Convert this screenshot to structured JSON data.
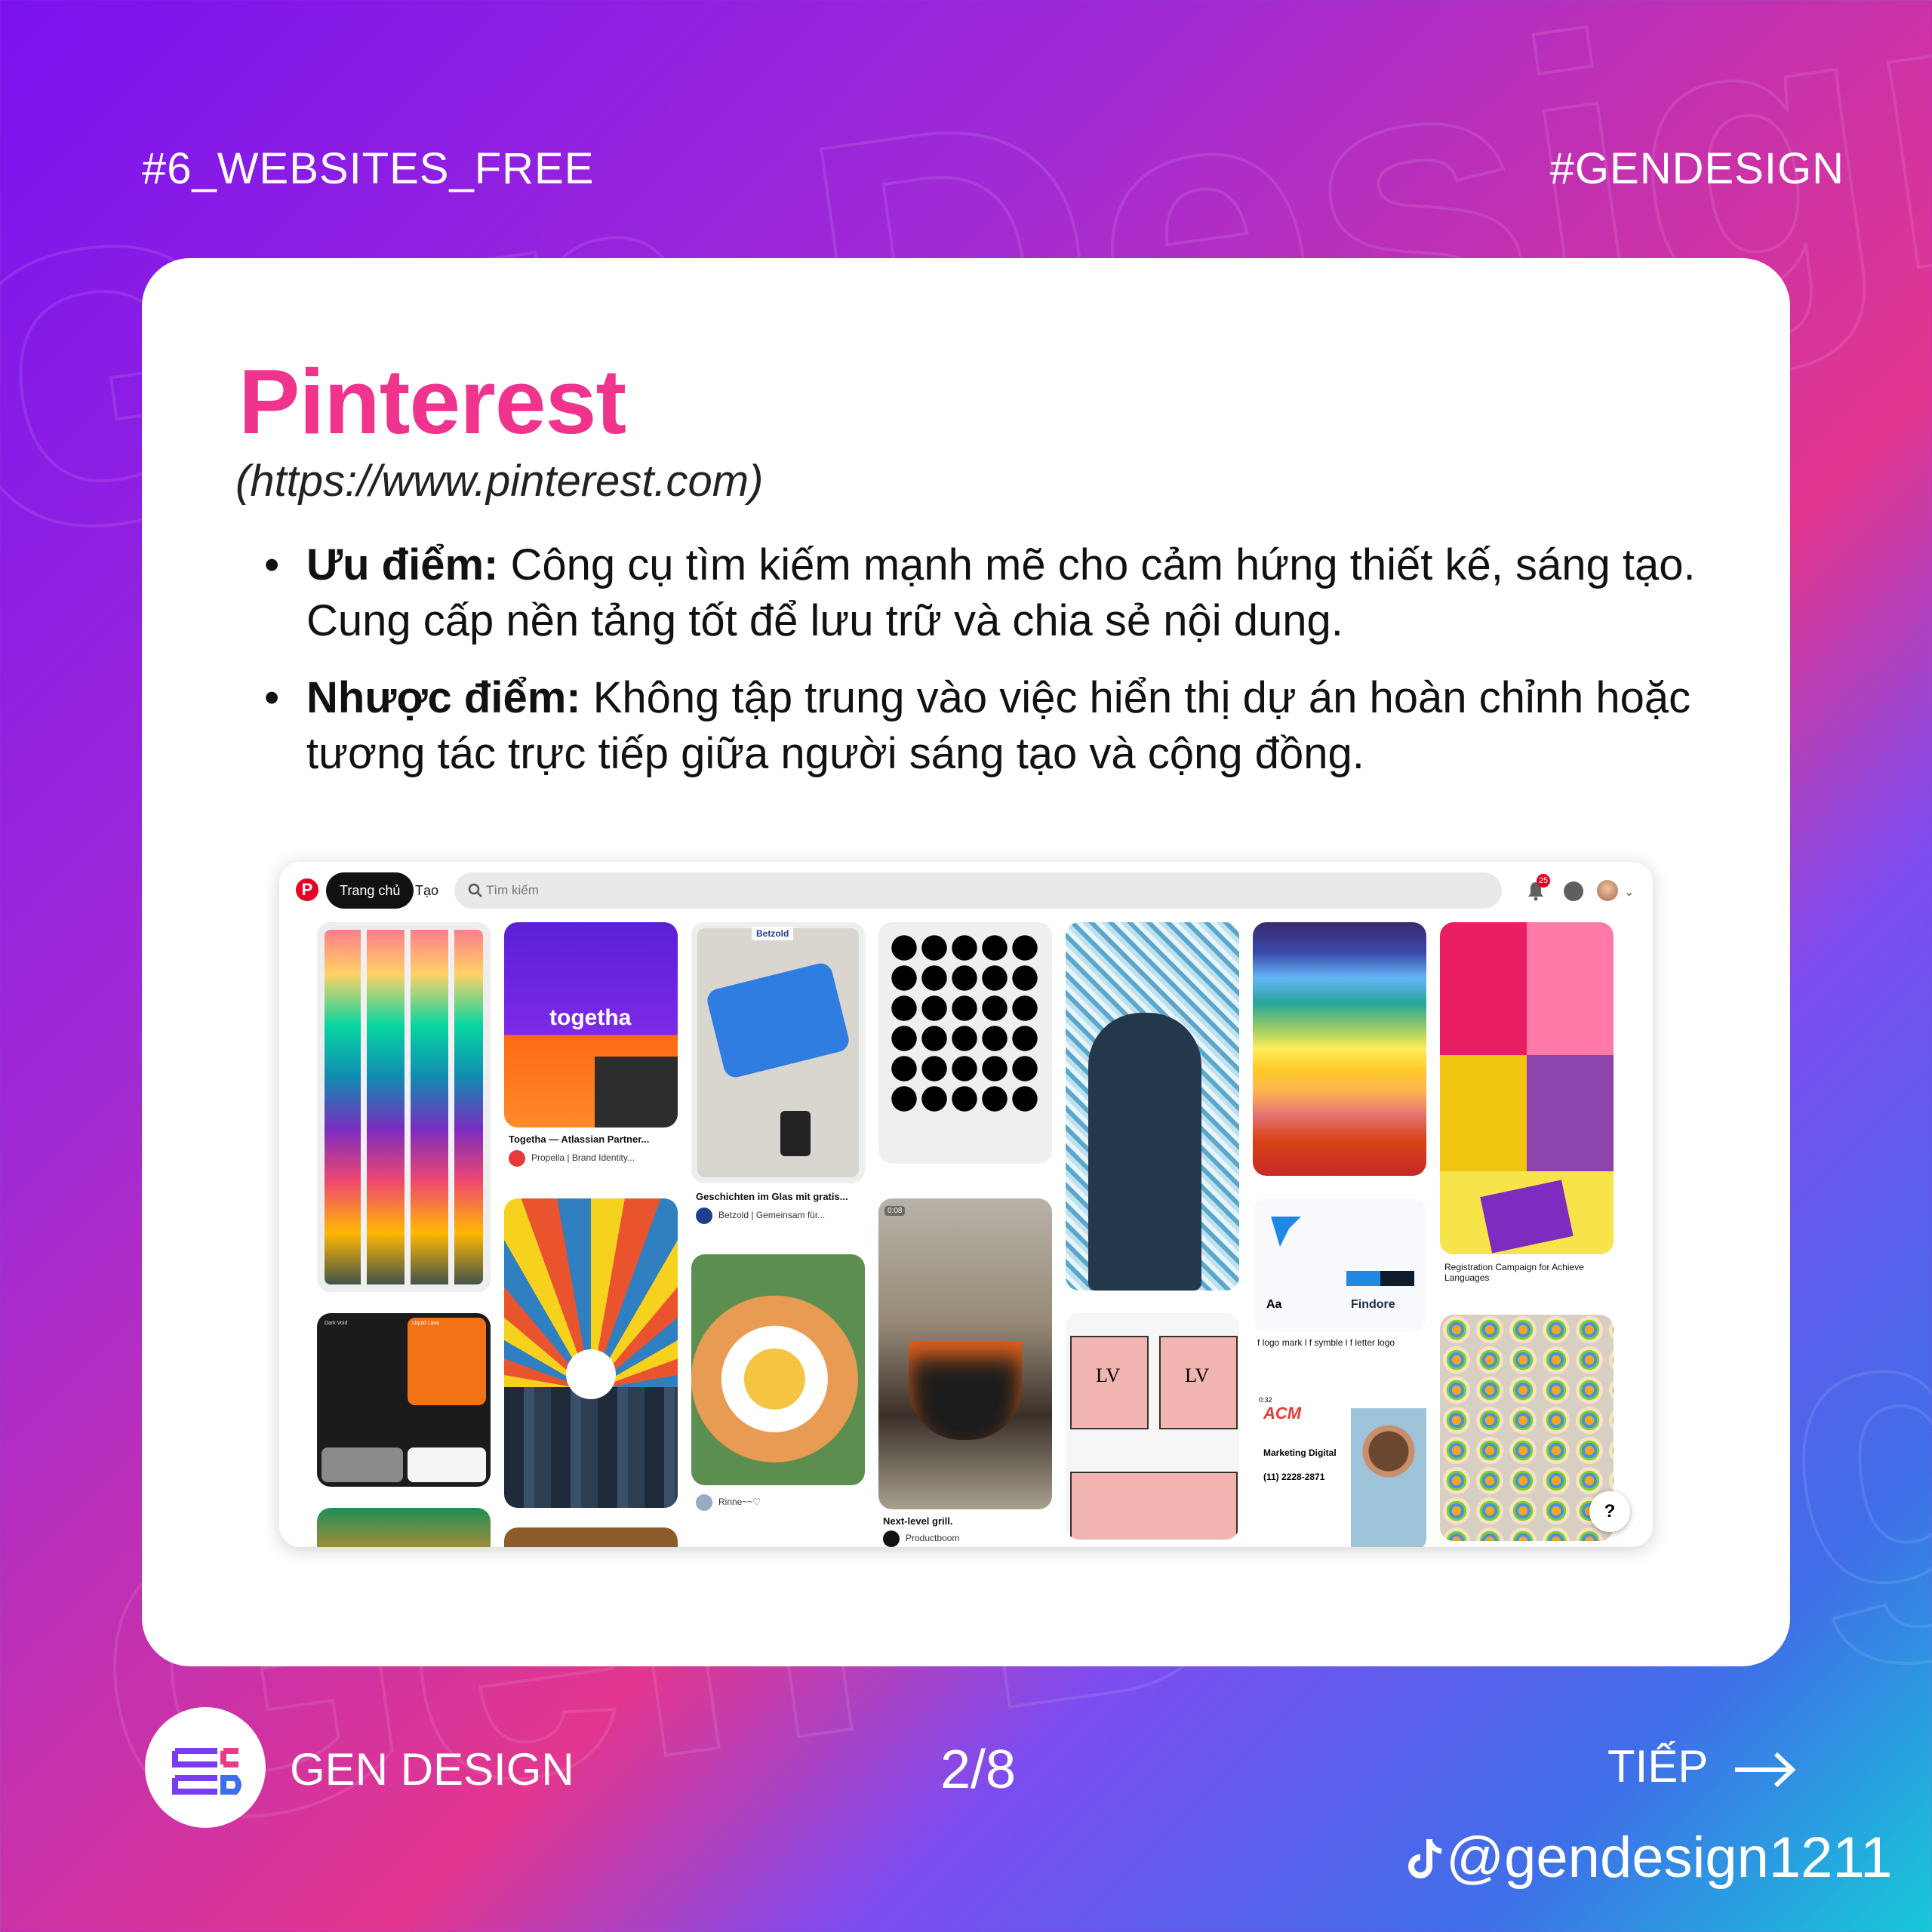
{
  "header": {
    "left_tag": "#6_WEBSITES_FREE",
    "right_tag": "#GENDESIGN"
  },
  "card": {
    "title": "Pinterest",
    "url": "(https://www.pinterest.com)",
    "bullets": [
      {
        "label": "Ưu điểm:",
        "text": " Công cụ tìm kiếm mạnh mẽ cho cảm hứng thiết kế, sáng tạo. Cung cấp nền tảng tốt để lưu trữ và chia sẻ nội dung."
      },
      {
        "label": "Nhược điểm:",
        "text": " Không tập trung vào việc hiển thị dự án hoàn chỉnh hoặc tương tác trực tiếp giữa người sáng tạo và cộng đồng."
      }
    ]
  },
  "pinterest": {
    "logo": "P",
    "home_button": "Trang chủ",
    "create_link": "Tạo",
    "search_placeholder": "Tìm kiếm",
    "notification_count": "25",
    "pins": {
      "togetha_logo": "togetha",
      "togetha_title": "Togetha — Atlassian Partner...",
      "togetha_source": "Propella | Brand Identity...",
      "betzold_tag": "Betzold",
      "glass_title": "Geschichten im Glas mit gratis...",
      "glass_source": "Betzold | Gemeinsam für...",
      "food_source": "Rinne~~♡",
      "grill_time": "0:08",
      "grill_title": "Next-level grill.",
      "grill_source": "Productboom",
      "logo_title": "f logo mark l f symble l f letter logo",
      "findore": "Findore",
      "findore_aa": "Aa",
      "louis_mark": "LV",
      "marketing_time": "0:32",
      "marketing_brand": "ACM",
      "marketing_title": "Marketing Digital",
      "marketing_phone": "(11) 2228-2871",
      "reg_title": "Registration Campaign for Achieve Languages",
      "palette_dark_title": "Dark Void",
      "palette_orange_title": "Liquid Lava"
    },
    "help": "?"
  },
  "footer": {
    "brand": "GEN DESIGN",
    "page": "2/8",
    "next_label": "TIẾP",
    "handle": "@gendesign1211"
  },
  "colors": {
    "pink": "#f0338d",
    "pinterest_red": "#e60023",
    "white": "#ffffff"
  },
  "icons": [
    "pinterest-logo-icon",
    "search-icon",
    "bell-icon",
    "chat-icon",
    "arrow-right-icon",
    "tiktok-icon"
  ]
}
